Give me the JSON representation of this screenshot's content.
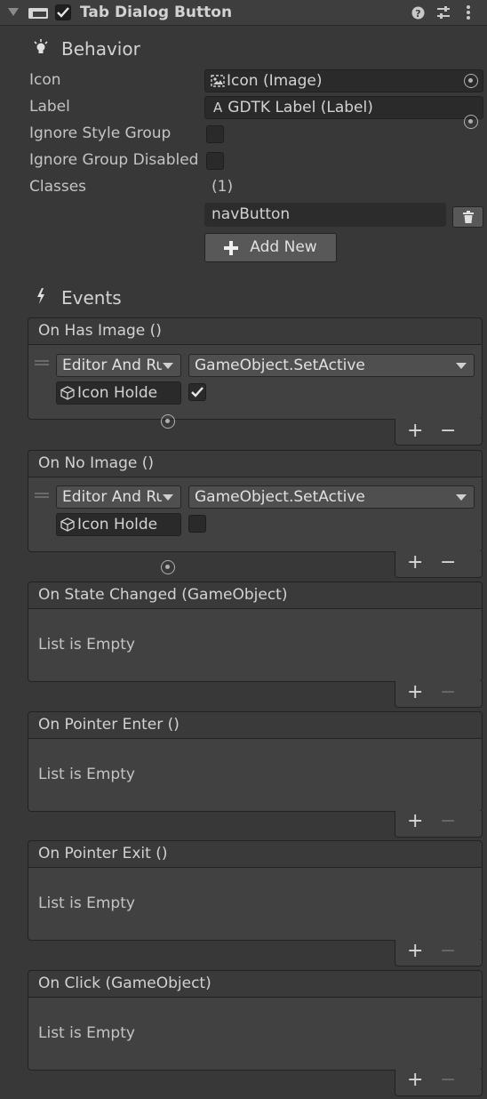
{
  "header": {
    "title": "Tab Dialog Button",
    "enabled": true,
    "icons": [
      "foldout-arrow-icon",
      "component-icon",
      "help-icon",
      "presets-icon",
      "kebab-menu-icon"
    ]
  },
  "behavior": {
    "title": "Behavior",
    "icon": "lightbulb-icon",
    "properties": {
      "icon": {
        "label": "Icon",
        "value": "Icon (Image)"
      },
      "label": {
        "label": "Label",
        "value": "GDTK Label (Label)",
        "type_glyph": "A"
      },
      "ignore_style_group": {
        "label": "Ignore Style Group",
        "checked": false
      },
      "ignore_group_disabled": {
        "label": "Ignore Group Disabled",
        "checked": false
      },
      "classes": {
        "label": "Classes",
        "count": "(1)",
        "items": [
          "navButton"
        ],
        "add_label": "Add New"
      }
    }
  },
  "events": {
    "title": "Events",
    "icon": "lightning-icon",
    "list": [
      {
        "name": "On Has Image ()",
        "runtime": "Editor And Ru",
        "function": "GameObject.SetActive",
        "target": "Icon Holde",
        "checked": true
      },
      {
        "name": "On No Image ()",
        "runtime": "Editor And Ru",
        "function": "GameObject.SetActive",
        "target": "Icon Holde",
        "checked": false
      },
      {
        "name": "On State Changed (GameObject)",
        "empty": "List is Empty"
      },
      {
        "name": "On Pointer Enter ()",
        "empty": "List is Empty"
      },
      {
        "name": "On Pointer Exit ()",
        "empty": "List is Empty"
      },
      {
        "name": "On Click (GameObject)",
        "empty": "List is Empty"
      }
    ],
    "plus": "+",
    "minus": "−"
  },
  "colors": {
    "background": "#383838",
    "field": "#2a2a2a",
    "button": "#585858",
    "text": "#c4c4c4"
  }
}
